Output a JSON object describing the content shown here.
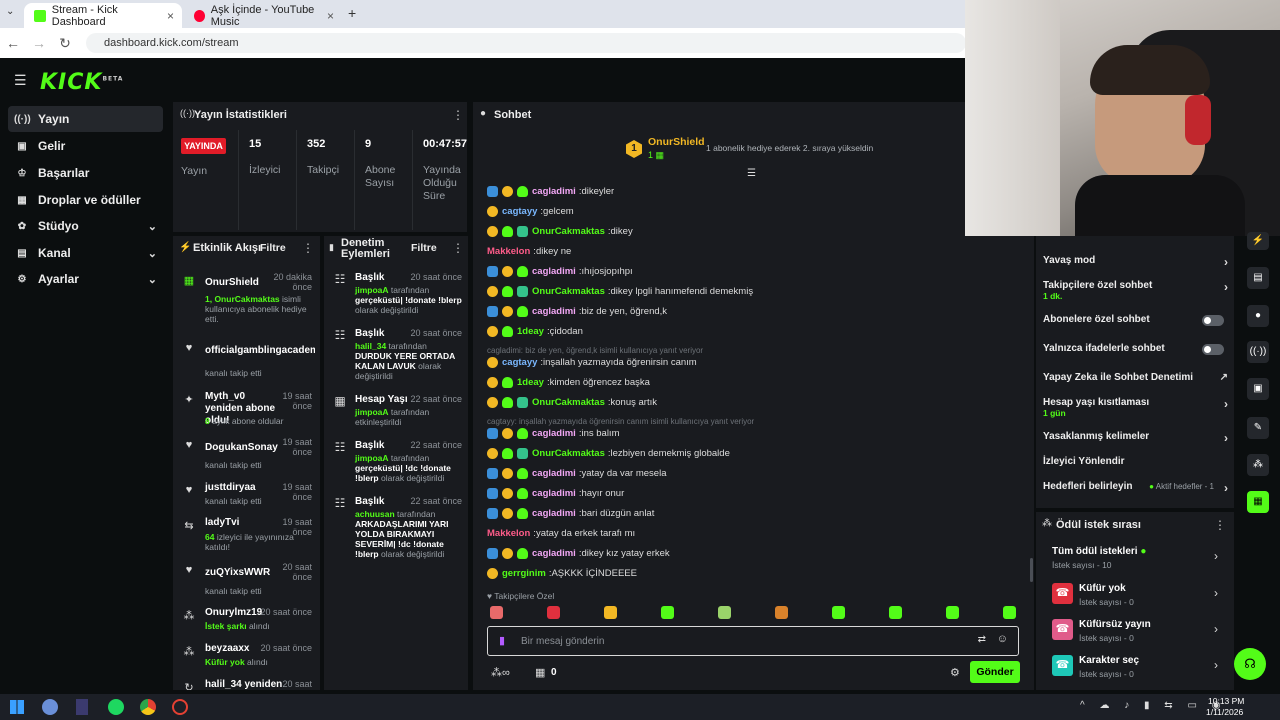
{
  "browser": {
    "tabs": [
      {
        "label": "Stream - Kick Dashboard",
        "active": true
      },
      {
        "label": "Aşk İçinde - YouTube Music",
        "active": false
      }
    ],
    "url": "dashboard.kick.com/stream"
  },
  "brand": {
    "logo": "KICK",
    "logo_sup": "BETA"
  },
  "sidebar": {
    "items": [
      {
        "label": "Yayın",
        "icon": "broadcast-icon"
      },
      {
        "label": "Gelir",
        "icon": "money-icon"
      },
      {
        "label": "Başarılar",
        "icon": "trophy-icon"
      },
      {
        "label": "Droplar ve ödüller",
        "icon": "gift-icon"
      },
      {
        "label": "Stüdyo",
        "icon": "studio-icon"
      },
      {
        "label": "Kanal",
        "icon": "channel-icon"
      },
      {
        "label": "Ayarlar",
        "icon": "gear-icon"
      }
    ]
  },
  "stats": {
    "title": "Yayın İstatistikleri",
    "live": "YAYINDA",
    "live_label": "Yayın",
    "viewers": "15",
    "viewers_label": "İzleyici",
    "followers": "352",
    "followers_label": "Takipçi",
    "subs": "9",
    "subs_label": "Abone Sayısı",
    "uptime": "00:47:57",
    "uptime_label": "Yayında Olduğu Süre"
  },
  "activity": {
    "title": "Etkinlik Akışı",
    "filter": "Filtre",
    "items": [
      {
        "name": "OnurShield",
        "time": "20 dakika önce",
        "desc_green": "1, OnurCakmaktas",
        "desc": " isimli kullanıcıya abonelik hediye etti."
      },
      {
        "name": "officialgamblingacadem",
        "time": "",
        "desc_green": "",
        "desc": "kanalı takip etti"
      },
      {
        "name": "Myth_v0 yeniden abone oldu!",
        "time": "19 saat önce",
        "desc_green": "8",
        "desc": " aylık abone oldular"
      },
      {
        "name": "DogukanSonay",
        "time": "19 saat önce",
        "desc_green": "",
        "desc": "kanalı takip etti"
      },
      {
        "name": "justtdiryaa",
        "time": "19 saat önce",
        "desc_green": "",
        "desc": "kanalı takip etti"
      },
      {
        "name": "ladyTvi",
        "time": "19 saat önce",
        "desc_green": "64",
        "desc": " izleyici ile yayınınıza katıldı!"
      },
      {
        "name": "zuQYixsWWR",
        "time": "20 saat önce",
        "desc_green": "",
        "desc": "kanalı takip etti"
      },
      {
        "name": "Onurylmz19",
        "time": "20 saat önce",
        "desc_green": "İstek şarkı",
        "desc": " alındı"
      },
      {
        "name": "beyzaaxx",
        "time": "20 saat önce",
        "desc_green": "Küfür yok",
        "desc": " alındı"
      },
      {
        "name": "halil_34 yeniden",
        "time": "20 saat",
        "desc_green": "",
        "desc": ""
      }
    ]
  },
  "moderation": {
    "title": "Denetim Eylemleri",
    "filter": "Filtre",
    "items": [
      {
        "title": "Başlık",
        "time": "20 saat önce",
        "user": "jimpoaA",
        "desc": " tarafından ",
        "bold": "gerçeküstü| !donate !blerp",
        "tail": " olarak değiştirildi"
      },
      {
        "title": "Başlık",
        "time": "20 saat önce",
        "user": "halil_34",
        "desc": " tarafından ",
        "bold": "DURDUK YERE ORTADA KALAN LAVUK",
        "tail": " olarak değiştirildi"
      },
      {
        "title": "Hesap Yaşı",
        "time": "22 saat önce",
        "user": "jimpoaA",
        "desc": " tarafından etkinleştirildi",
        "bold": "",
        "tail": ""
      },
      {
        "title": "Başlık",
        "time": "22 saat önce",
        "user": "jimpoaA",
        "desc": " tarafından ",
        "bold": "gerçeküstü| !dc !donate !blerp",
        "tail": " olarak değiştirildi"
      },
      {
        "title": "Başlık",
        "time": "22 saat önce",
        "user": "achuusan",
        "desc": " tarafından ",
        "bold": "ARKADAŞLARIMI YARI YOLDA BIRAKMAYI SEVERİM| !dc !donate !blerp",
        "tail": " olarak değiştirildi"
      }
    ]
  },
  "chat": {
    "title": "Sohbet",
    "pinned_user": "OnurShield",
    "pinned_count": "1",
    "pinned_text": "1 abonelik hediye ederek 2. sıraya yükseldin",
    "messages": [
      {
        "user": "cagladimi",
        "color": "#f2a7f5",
        "badges": [
          "b-blue",
          "b-gold",
          "b-green"
        ],
        "text": "dikeyler"
      },
      {
        "user": "cagtayy",
        "color": "#7ab8ff",
        "badges": [
          "b-gold"
        ],
        "text": "gelcem"
      },
      {
        "user": "OnurCakmaktas",
        "color": "#53fc18",
        "badges": [
          "b-gold",
          "b-green",
          "b-sub"
        ],
        "text": "dikey"
      },
      {
        "user": "Makkelon",
        "color": "#ff5c8a",
        "badges": [],
        "text": "dikey ne"
      },
      {
        "user": "cagladimi",
        "color": "#f2a7f5",
        "badges": [
          "b-blue",
          "b-gold",
          "b-green"
        ],
        "text": "ıhıjosjopıhpı"
      },
      {
        "user": "OnurCakmaktas",
        "color": "#53fc18",
        "badges": [
          "b-gold",
          "b-green",
          "b-sub"
        ],
        "text": "dikey lpgli hanımefendi demekmiş"
      },
      {
        "user": "cagladimi",
        "color": "#f2a7f5",
        "badges": [
          "b-blue",
          "b-gold",
          "b-green"
        ],
        "text": "biz de yen, öğrend,k"
      },
      {
        "user": "1deay",
        "color": "#53fc18",
        "badges": [
          "b-gold",
          "b-green"
        ],
        "text": "çidodan"
      },
      {
        "reply": "cagladimi: biz de yen, öğrend,k isimli kullanıcıya yanıt veriyor"
      },
      {
        "user": "cagtayy",
        "color": "#7ab8ff",
        "badges": [
          "b-gold"
        ],
        "text": "inşallah yazmayıda öğrenirsin canım"
      },
      {
        "user": "1deay",
        "color": "#53fc18",
        "badges": [
          "b-gold",
          "b-green"
        ],
        "text": "kimden öğrencez başka"
      },
      {
        "user": "OnurCakmaktas",
        "color": "#53fc18",
        "badges": [
          "b-gold",
          "b-green",
          "b-sub"
        ],
        "text": "konuş artık"
      },
      {
        "reply": "cagtayy: inşallah yazmayıda öğrenirsin canım isimli kullanıcıya yanıt veriyor"
      },
      {
        "user": "cagladimi",
        "color": "#f2a7f5",
        "badges": [
          "b-blue",
          "b-gold",
          "b-green"
        ],
        "text": "ins balım"
      },
      {
        "user": "OnurCakmaktas",
        "color": "#53fc18",
        "badges": [
          "b-gold",
          "b-green",
          "b-sub"
        ],
        "text": "lezbiyen demekmiş globalde"
      },
      {
        "user": "cagladimi",
        "color": "#f2a7f5",
        "badges": [
          "b-blue",
          "b-gold",
          "b-green"
        ],
        "text": "yatay da var mesela"
      },
      {
        "user": "cagladimi",
        "color": "#f2a7f5",
        "badges": [
          "b-blue",
          "b-gold",
          "b-green"
        ],
        "text": "hayır onur"
      },
      {
        "user": "cagladimi",
        "color": "#f2a7f5",
        "badges": [
          "b-blue",
          "b-gold",
          "b-green"
        ],
        "text": "bari düzgün anlat"
      },
      {
        "user": "Makkelon",
        "color": "#ff5c8a",
        "badges": [],
        "text": "yatay da erkek tarafı mı"
      },
      {
        "user": "cagladimi",
        "color": "#f2a7f5",
        "badges": [
          "b-blue",
          "b-gold",
          "b-green"
        ],
        "text": "dikey kız yatay erkek"
      },
      {
        "user": "gerrginim",
        "color": "#53fc18",
        "badges": [
          "b-gold"
        ],
        "text": "AŞKKK İÇİNDEEEE"
      }
    ],
    "followers_only": "Takipçilere Özel",
    "input_placeholder": "Bir mesaj gönderin",
    "points": "0",
    "send": "Gönder"
  },
  "chat_settings": {
    "items": [
      {
        "label": "Yavaş mod",
        "sub": "",
        "type": "chevron"
      },
      {
        "label": "Takipçilere özel sohbet",
        "sub": "1 dk.",
        "type": "chevron"
      },
      {
        "label": "Abonelere özel sohbet",
        "sub": "",
        "type": "toggle"
      },
      {
        "label": "Yalnızca ifadelerle sohbet",
        "sub": "",
        "type": "toggle"
      },
      {
        "label": "Yapay Zeka ile Sohbet Denetimi",
        "sub": "",
        "type": "external"
      },
      {
        "label": "Hesap yaşı kısıtlaması",
        "sub": "1 gün",
        "type": "chevron"
      },
      {
        "label": "Yasaklanmış kelimeler",
        "sub": "",
        "type": "chevron"
      },
      {
        "label": "İzleyici Yönlendir",
        "sub": "",
        "type": "none"
      },
      {
        "label": "Hedefleri belirleyin",
        "sub": "",
        "type": "chevron",
        "extra": "Aktif hedefler - 1"
      }
    ]
  },
  "rewards": {
    "title": "Ödül istek sırası",
    "all": "Tüm ödül istekleri",
    "all_sub": "İstek sayısı - 10",
    "items": [
      {
        "title": "Küfür yok",
        "sub": "İstek sayısı - 0",
        "color": "#e0303e"
      },
      {
        "title": "Küfürsüz yayın",
        "sub": "İstek sayısı - 0",
        "color": "#e05b8a"
      },
      {
        "title": "Karakter seç",
        "sub": "İstek sayısı - 0",
        "color": "#1ec8b8"
      }
    ]
  },
  "taskbar": {
    "time": "10:13 PM",
    "date": "1/11/2026"
  }
}
